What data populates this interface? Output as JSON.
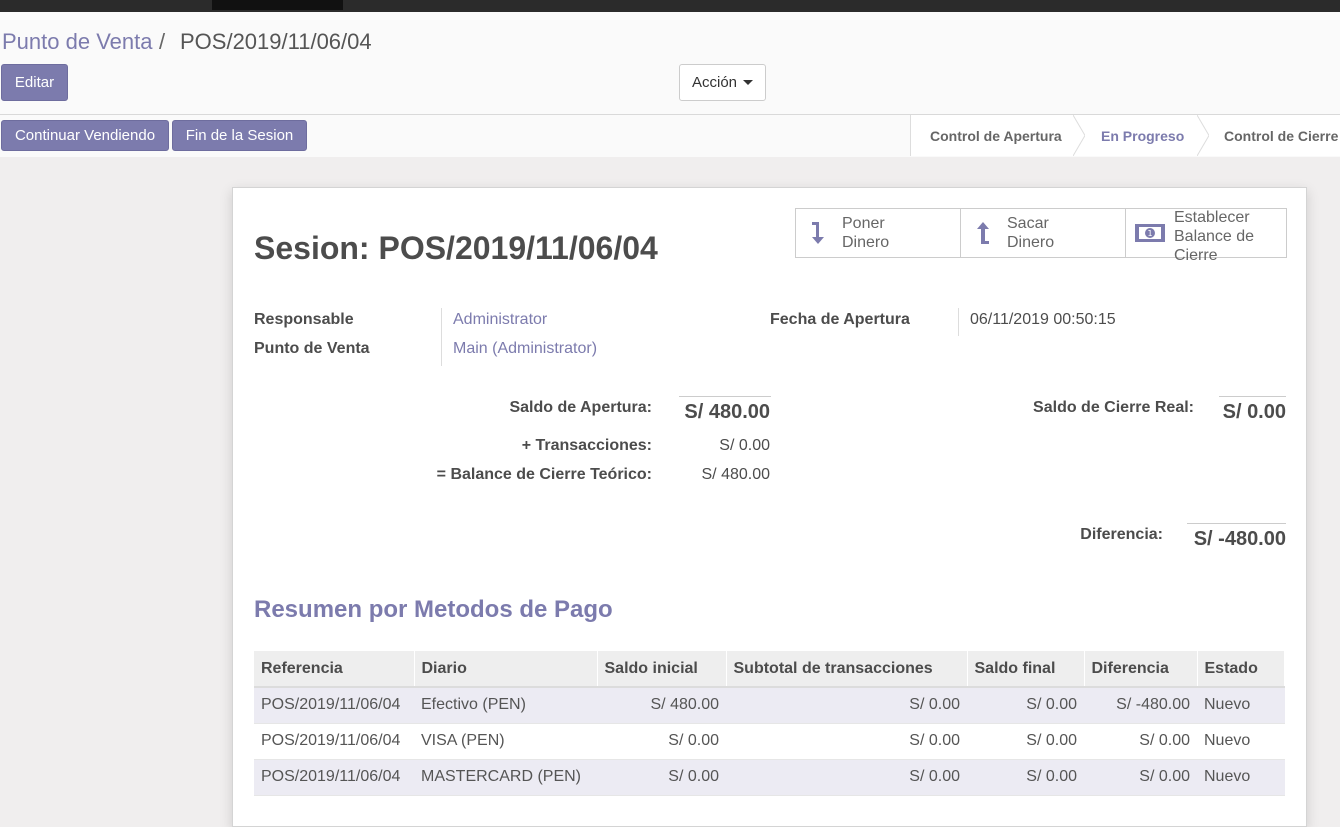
{
  "breadcrumb": {
    "root": "Punto de Venta",
    "separator": "/",
    "current": "POS/2019/11/06/04"
  },
  "buttons": {
    "edit": "Editar",
    "action": "Acción",
    "continue_selling": "Continuar Vendiendo",
    "end_session": "Fin de la Sesion"
  },
  "statusbar": {
    "stages": [
      "Control de Apertura",
      "En Progreso",
      "Control de Cierre"
    ],
    "active_index": 1
  },
  "sheet": {
    "title": "Sesion: POS/2019/11/06/04",
    "stat_buttons": [
      {
        "label": "Poner\nDinero",
        "icon": "money-in-icon"
      },
      {
        "label": "Sacar\nDinero",
        "icon": "money-out-icon"
      },
      {
        "label": "Establecer\nBalance de\nCierre",
        "icon": "cash-icon"
      }
    ],
    "fields": {
      "responsable_label": "Responsable",
      "responsable_value": "Administrator",
      "punto_label": "Punto de Venta",
      "punto_value": "Main (Administrator)",
      "fecha_label": "Fecha de Apertura",
      "fecha_value": "06/11/2019 00:50:15"
    },
    "balances": {
      "saldo_apertura_label": "Saldo de Apertura:",
      "saldo_apertura_value": "S/ 480.00",
      "transacciones_label": "+ Transacciones:",
      "transacciones_value": "S/ 0.00",
      "teorico_label": "= Balance de Cierre Teórico:",
      "teorico_value": "S/ 480.00",
      "cierre_real_label": "Saldo de Cierre Real:",
      "cierre_real_value": "S/ 0.00",
      "diferencia_label": "Diferencia:",
      "diferencia_value": "S/ -480.00"
    },
    "summary": {
      "title": "Resumen por Metodos de Pago",
      "columns": [
        "Referencia",
        "Diario",
        "Saldo inicial",
        "Subtotal de transacciones",
        "Saldo final",
        "Diferencia",
        "Estado"
      ],
      "rows": [
        [
          "POS/2019/11/06/04",
          "Efectivo (PEN)",
          "S/ 480.00",
          "S/ 0.00",
          "S/ 0.00",
          "S/ -480.00",
          "Nuevo"
        ],
        [
          "POS/2019/11/06/04",
          "VISA (PEN)",
          "S/ 0.00",
          "S/ 0.00",
          "S/ 0.00",
          "S/ 0.00",
          "Nuevo"
        ],
        [
          "POS/2019/11/06/04",
          "MASTERCARD (PEN)",
          "S/ 0.00",
          "S/ 0.00",
          "S/ 0.00",
          "S/ 0.00",
          "Nuevo"
        ]
      ]
    }
  },
  "colors": {
    "accent": "#7c7bad",
    "topbar": "#2b2b2b"
  }
}
